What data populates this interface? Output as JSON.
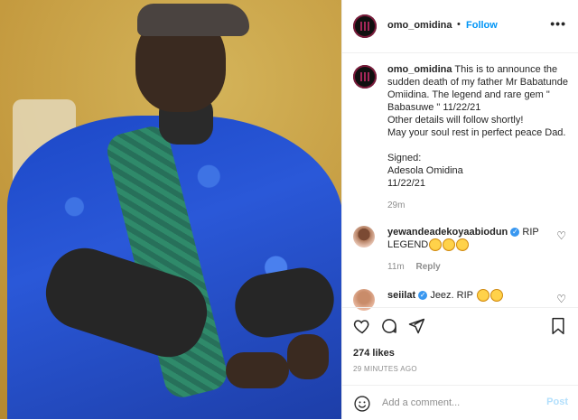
{
  "header": {
    "username": "omo_omidina",
    "separator": "•",
    "follow_label": "Follow",
    "more_label": "•••"
  },
  "caption": {
    "username": "omo_omidina",
    "lines": [
      "This is to announce the sudden death of my father Mr Babatunde Omiidina. The legend and rare gem \" Babasuwe \" 11/22/21",
      "Other details will follow shortly!",
      "May your soul rest in perfect peace Dad."
    ],
    "signed_label": "Signed:",
    "signer": "Adesola Omidina",
    "signed_date": "11/22/21",
    "time": "29m"
  },
  "comments": [
    {
      "username": "yewandeadekoyaabiodun",
      "verified": true,
      "text": "RIP LEGEND",
      "emoji_count": 3,
      "time": "11m",
      "reply_label": "Reply"
    },
    {
      "username": "seiilat",
      "verified": true,
      "text": "Jeez. RIP",
      "emoji_count": 2
    }
  ],
  "actions": {
    "like_icon": "heart-outline-icon",
    "comment_icon": "comment-bubble-icon",
    "share_icon": "paper-plane-icon",
    "save_icon": "bookmark-icon"
  },
  "likes": "274 likes",
  "time_ago": "29 MINUTES AGO",
  "add_comment": {
    "placeholder": "Add a comment...",
    "post_label": "Post"
  },
  "colors": {
    "accent": "#0095f6",
    "post_disabled": "#b2dffc",
    "muted": "#8e8e8e",
    "text": "#262626",
    "verified": "#3897f0"
  }
}
